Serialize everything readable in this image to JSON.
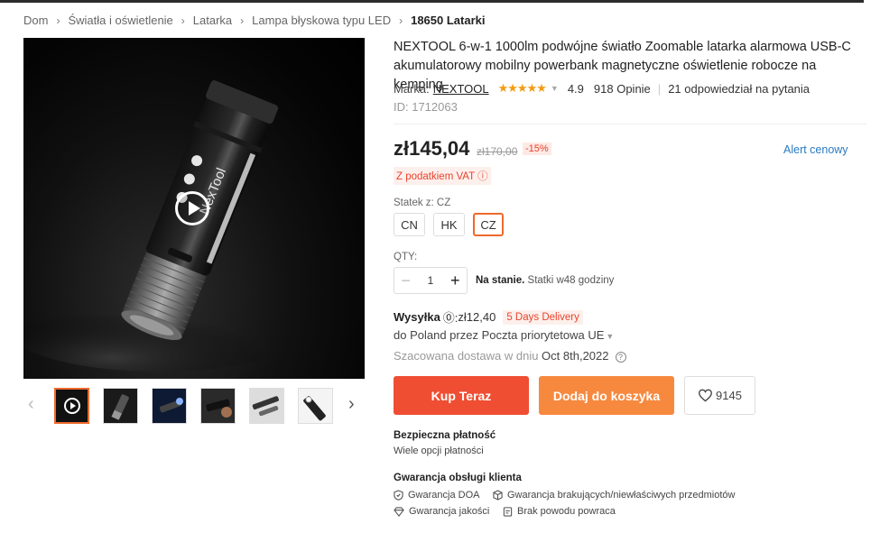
{
  "breadcrumb": {
    "items": [
      "Dom",
      "Światła i oświetlenie",
      "Latarka",
      "Lampa błyskowa typu LED"
    ],
    "current": "18650 Latarki"
  },
  "product": {
    "title": "NEXTOOL 6-w-1 1000lm podwójne światło Zoomable latarka alarmowa USB-C akumulatorowy mobilny powerbank magnetyczne oświetlenie robocze na kemping",
    "brand_label": "Marka:",
    "brand": "NEXTOOL",
    "stars": "★★★★★",
    "rating": "4.9",
    "reviews": "918 Opinie",
    "answers": "21 odpowiedział na pytania",
    "id": "ID: 1712063",
    "flashlight_brand_text": "NexTool"
  },
  "price": {
    "current": "zł145,04",
    "old": "zł170,00",
    "discount": "-15%",
    "alert": "Alert cenowy",
    "vat": "Z podatkiem VAT ⓘ"
  },
  "ship_from": {
    "label": "Statek z: CZ",
    "options": [
      "CN",
      "HK",
      "CZ"
    ],
    "selected": "CZ"
  },
  "quantity": {
    "label": "QTY:",
    "value": "1",
    "minus": "−",
    "plus": "+",
    "stock_bold": "Na stanie.",
    "stock_text": " Statki w48 godziny"
  },
  "shipping": {
    "label": "Wysyłka",
    "info_glyph": "⓪:",
    "cost": " zł12,40",
    "badge": "5 Days Delivery",
    "method": "do Poland przez Poczta priorytetowa UE",
    "est_label": "Szacowana dostawa w dniu ",
    "est_date": "Oct 8th,2022"
  },
  "actions": {
    "buy": "Kup Teraz",
    "cart": "Dodaj do koszyka",
    "wishlist_count": "9145"
  },
  "payment": {
    "title": "Bezpieczna płatność",
    "text": "Wiele opcji płatności"
  },
  "guarantee": {
    "title": "Gwarancja obsługi klienta",
    "items": [
      "Gwarancja DOA",
      "Gwarancja brakujących/niewłaściwych przedmiotów",
      "Gwarancja jakości",
      "Brak powodu powraca"
    ]
  },
  "colors": {
    "accent": "#ef4e33",
    "cart": "#f7893f",
    "thumb_active": "#ee6a2c",
    "link": "#2a7ac0",
    "star": "#f39c12"
  }
}
